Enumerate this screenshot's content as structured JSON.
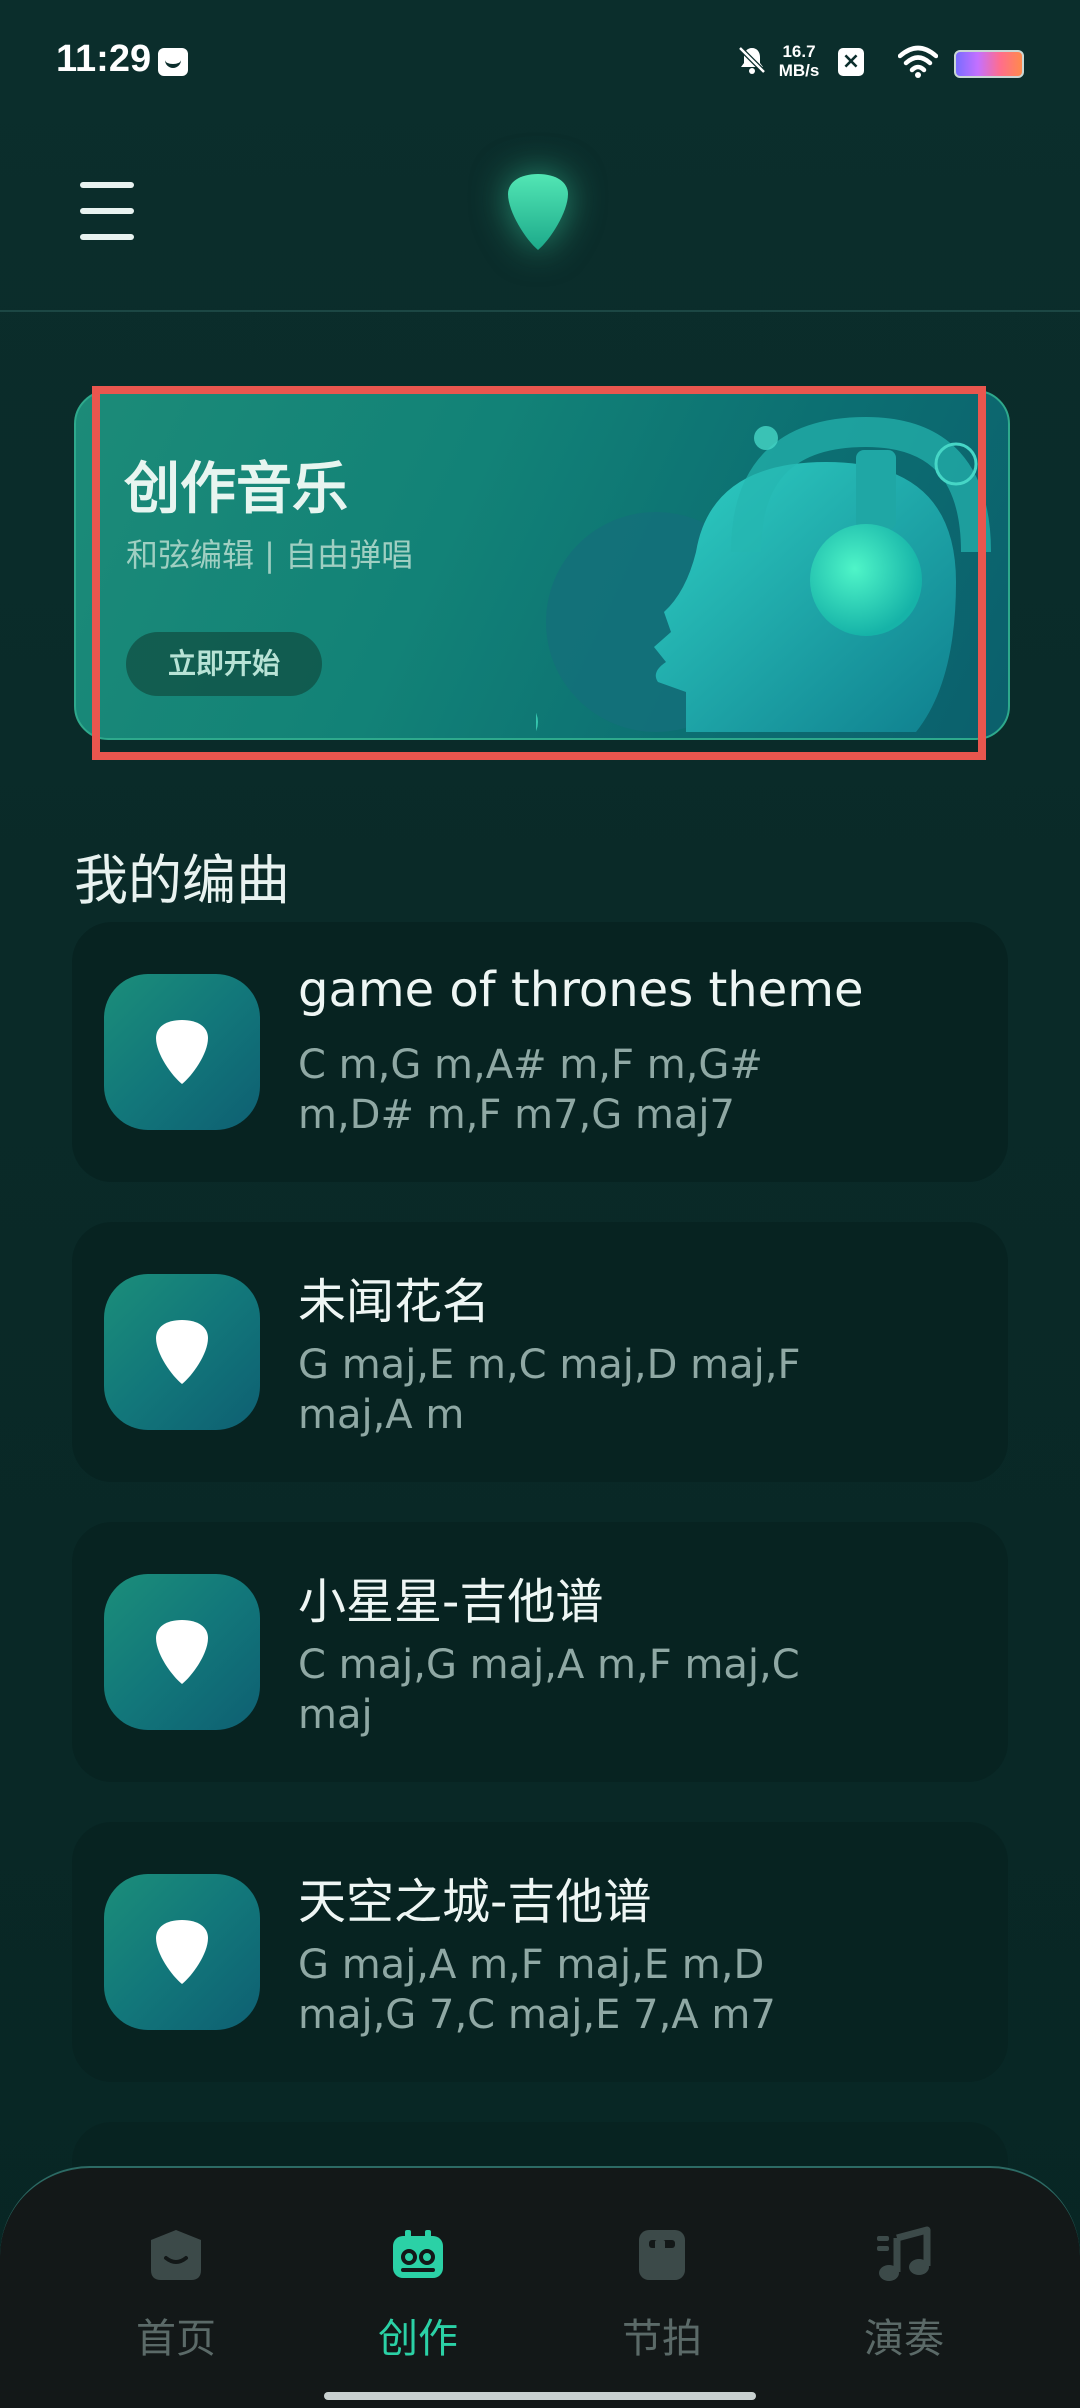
{
  "status_bar": {
    "time": "11:29",
    "network_speed_value": "16.7",
    "network_speed_unit": "MB/s",
    "icons": [
      "message-icon",
      "bell-off-icon",
      "x-box-icon",
      "wifi-icon",
      "battery-icon"
    ]
  },
  "header": {
    "menu_icon": "menu-icon",
    "logo_icon": "guitar-pick-icon"
  },
  "banner": {
    "title": "创作音乐",
    "subtitle": "和弦编辑 | 自由弹唱",
    "button_label": "立即开始"
  },
  "section": {
    "title": "我的编曲"
  },
  "songs": [
    {
      "title": "game of thrones theme",
      "chords": "C m,G m,A# m,F m,G# m,D# m,F m7,G maj7"
    },
    {
      "title": "未闻花名",
      "chords": "G maj,E m,C maj,D maj,F maj,A m"
    },
    {
      "title": "小星星-吉他谱",
      "chords": "C maj,G maj,A m,F maj,C maj"
    },
    {
      "title": "天空之城-吉他谱",
      "chords": "G maj,A m,F maj,E m,D maj,G 7,C maj,E 7,A m7"
    }
  ],
  "bottom_nav": {
    "items": [
      {
        "label": "首页",
        "icon": "home-icon",
        "active": false
      },
      {
        "label": "创作",
        "icon": "create-icon",
        "active": true
      },
      {
        "label": "节拍",
        "icon": "metronome-icon",
        "active": false
      },
      {
        "label": "演奏",
        "icon": "music-note-icon",
        "active": false
      }
    ]
  },
  "colors": {
    "background": "#0a2b29",
    "accent": "#2bd1a6",
    "card": "#072321",
    "highlight_border": "#e9564e"
  }
}
